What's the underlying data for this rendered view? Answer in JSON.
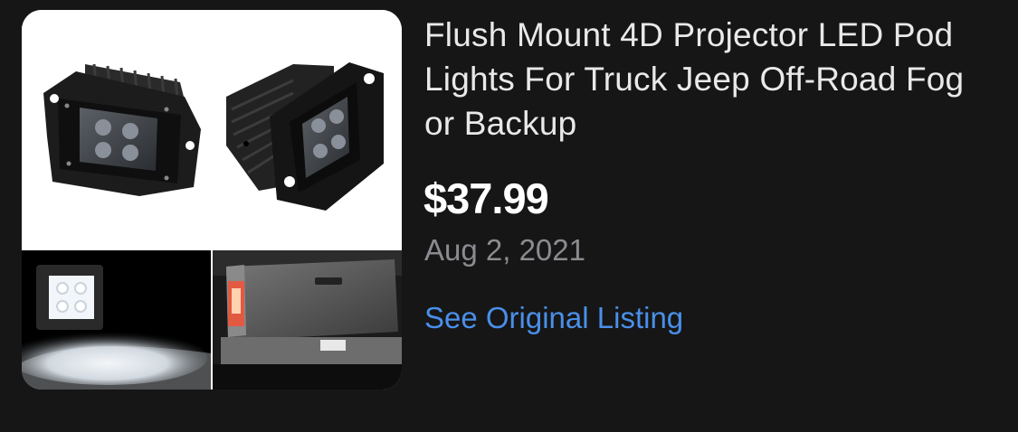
{
  "listing": {
    "title": "Flush Mount 4D Projector LED Pod Lights For Truck Jeep Off-Road Fog or Backup",
    "price": "$37.99",
    "date": "Aug 2, 2021",
    "link_label": "See Original Listing"
  },
  "colors": {
    "background": "#161616",
    "title": "#e9e9ea",
    "price": "#ffffff",
    "date": "#8b8b90",
    "link": "#4a8fe9"
  }
}
